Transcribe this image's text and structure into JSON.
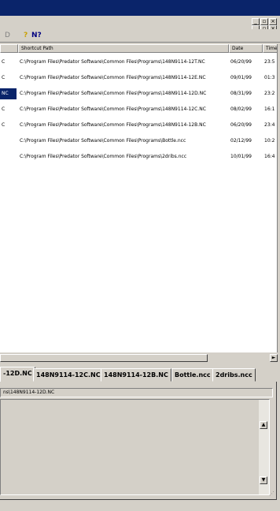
{
  "window": {
    "controls": {
      "minimize": "_",
      "restore": "▫",
      "close": "×"
    }
  },
  "toolbar": {
    "items": [
      {
        "label": "D",
        "name": "toolbar-button-nav"
      },
      {
        "label": "?",
        "name": "toolbar-help-button"
      },
      {
        "label": "N?",
        "name": "toolbar-context-help-button"
      }
    ],
    "help_color": "#c8a000",
    "context_help_color": "#000080"
  },
  "list": {
    "columns": [
      "Shortcut Path",
      "Date",
      "Time"
    ],
    "rows": [
      {
        "prefix": "C",
        "path": "C:\\Program Files\\Predator Software\\Common Files\\Programs\\148N9114-12T.NC",
        "date": "06/20/99",
        "time": "23:5",
        "selected": false
      },
      {
        "prefix": "C",
        "path": "C:\\Program Files\\Predator Software\\Common Files\\Programs\\148N9114-12E.NC",
        "date": "09/01/99",
        "time": "01:3",
        "selected": false
      },
      {
        "prefix": "NC",
        "path": "C:\\Program Files\\Predator Software\\Common Files\\Programs\\148N9114-12D.NC",
        "date": "08/31/99",
        "time": "23:2",
        "selected": true
      },
      {
        "prefix": "C",
        "path": "C:\\Program Files\\Predator Software\\Common Files\\Programs\\148N9114-12C.NC",
        "date": "08/02/99",
        "time": "16:1",
        "selected": false
      },
      {
        "prefix": "C",
        "path": "C:\\Program Files\\Predator Software\\Common Files\\Programs\\148N9114-12B.NC",
        "date": "06/20/99",
        "time": "23:4",
        "selected": false
      },
      {
        "prefix": "",
        "path": "C:\\Program Files\\Predator Software\\Common Files\\Programs\\Bottle.ncc",
        "date": "02/12/99",
        "time": "10:2",
        "selected": false
      },
      {
        "prefix": "",
        "path": "C:\\Program Files\\Predator Software\\Common Files\\Programs\\2dribs.ncc",
        "date": "10/01/99",
        "time": "16:4",
        "selected": false
      }
    ]
  },
  "tabs": [
    "-12D.NC",
    "148N9114-12C.NC",
    "148N9114-12B.NC",
    "Bottle.ncc",
    "2dribs.ncc"
  ],
  "editor": {
    "path": "ns\\148N9114-12D.NC"
  },
  "scroll": {
    "left": "◄",
    "right": "►",
    "up": "▲",
    "down": "▼"
  }
}
